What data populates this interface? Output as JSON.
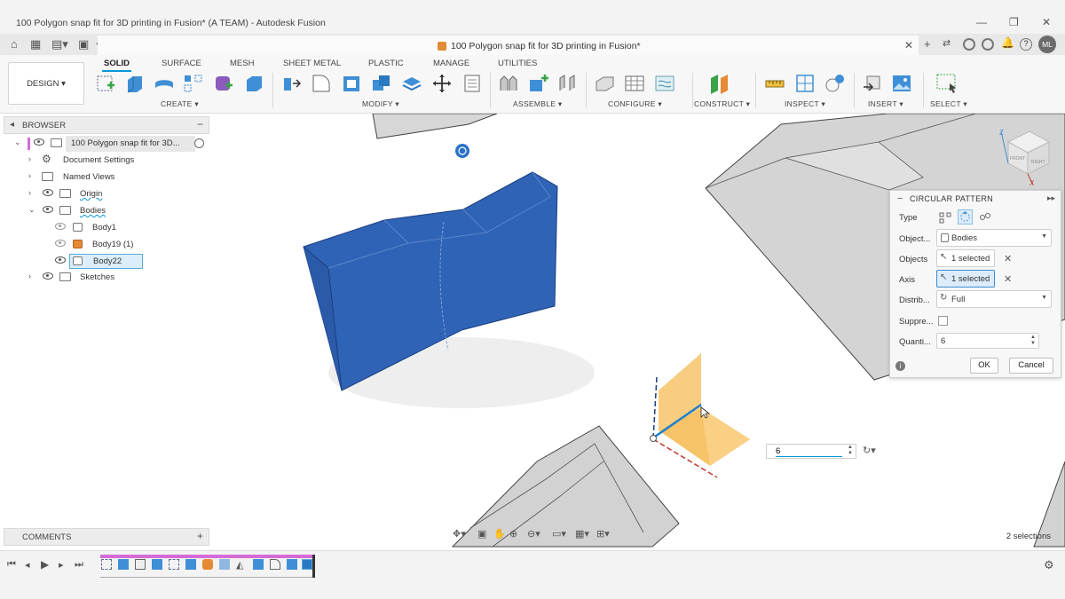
{
  "window": {
    "title": "100 Polygon snap fit for 3D printing in Fusion* (A TEAM) - Autodesk Fusion",
    "controls": [
      "—",
      "❐",
      "✕"
    ]
  },
  "document_tab": {
    "title": "100 Polygon snap fit for 3D printing in Fusion*"
  },
  "toolbar": {
    "workspace": "DESIGN",
    "tabs": [
      "SOLID",
      "SURFACE",
      "MESH",
      "SHEET METAL",
      "PLASTIC",
      "MANAGE",
      "UTILITIES"
    ],
    "active_tab": "SOLID",
    "groups": {
      "create": "CREATE",
      "modify": "MODIFY",
      "assemble": "ASSEMBLE",
      "configure": "CONFIGURE",
      "construct": "CONSTRUCT",
      "inspect": "INSPECT",
      "insert": "INSERT",
      "select": "SELECT"
    }
  },
  "browser": {
    "header": "BROWSER",
    "items": [
      {
        "label": "100 Polygon snap fit for 3D..."
      },
      {
        "label": "Document Settings"
      },
      {
        "label": "Named Views"
      },
      {
        "label": "Origin"
      },
      {
        "label": "Bodies"
      },
      {
        "label": "Body1"
      },
      {
        "label": "Body19 (1)"
      },
      {
        "label": "Body22"
      },
      {
        "label": "Sketches"
      }
    ]
  },
  "comments": {
    "header": "COMMENTS"
  },
  "dialog": {
    "title": "CIRCULAR PATTERN",
    "type_label": "Type",
    "object_type_label": "Object...",
    "object_type_value": "Bodies",
    "objects_label": "Objects",
    "objects_value": "1 selected",
    "axis_label": "Axis",
    "axis_value": "1 selected",
    "distribution_label": "Distrib...",
    "distribution_value": "Full",
    "suppress_label": "Suppre...",
    "quantity_label": "Quanti...",
    "quantity_value": "6",
    "ok": "OK",
    "cancel": "Cancel"
  },
  "canvas": {
    "inline_quantity": "6",
    "selections": "2 selections",
    "viewcube": {
      "front": "FRONT",
      "right": "RIGHT",
      "axis_z": "Z",
      "axis_x": "X"
    }
  },
  "colors": {
    "accent": "#0696d7",
    "body_blue": "#2f63b5",
    "gray_body": "#d2d2d2",
    "preview_orange": "#f7c46a"
  }
}
